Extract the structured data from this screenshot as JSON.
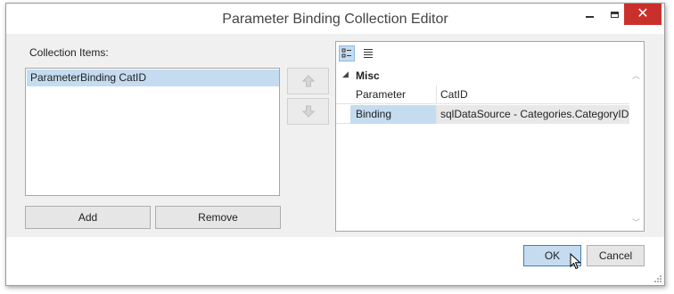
{
  "window": {
    "title": "Parameter Binding Collection Editor"
  },
  "collection": {
    "label": "Collection Items:",
    "items": [
      {
        "label": "ParameterBinding CatID"
      }
    ],
    "add_label": "Add",
    "remove_label": "Remove"
  },
  "property_grid": {
    "category": "Misc",
    "rows": [
      {
        "name": "Parameter Name",
        "value": "CatID"
      },
      {
        "name": "Binding",
        "value": "sqlDataSource - Categories.CategoryID"
      }
    ]
  },
  "footer": {
    "ok_label": "OK",
    "cancel_label": "Cancel"
  },
  "icons": {
    "minimize": "minimize-icon",
    "maximize": "maximize-icon",
    "close": "close-icon",
    "move_up": "arrow-up-icon",
    "move_down": "arrow-down-icon",
    "categorized": "categorized-view-icon",
    "alphabetical": "alphabetical-view-icon"
  },
  "colors": {
    "selection": "#c5dcf0",
    "close_button": "#c9302c",
    "dialog_background": "#f0f0f0"
  }
}
